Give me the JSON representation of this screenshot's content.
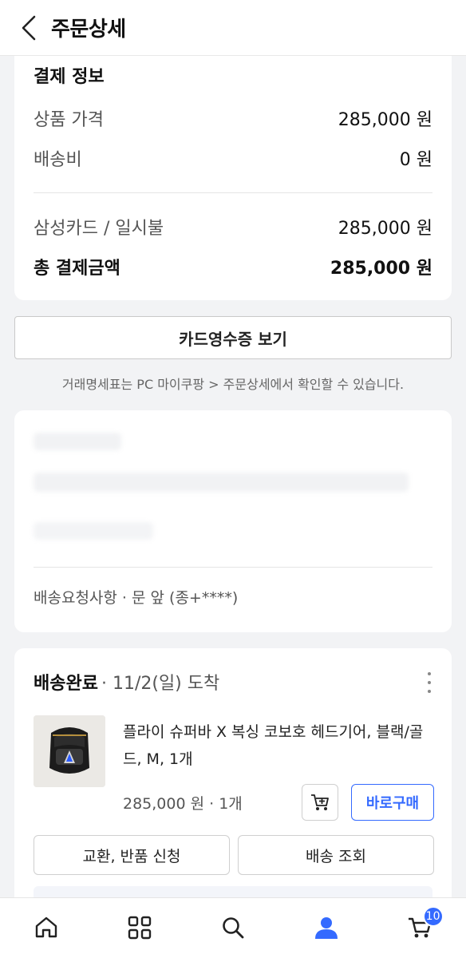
{
  "header": {
    "title": "주문상세"
  },
  "payment": {
    "section_title": "결제 정보",
    "rows": [
      {
        "label": "상품 가격",
        "value": "285,000 원"
      },
      {
        "label": "배송비",
        "value": "0 원"
      }
    ],
    "method": {
      "label": "삼성카드 / 일시불",
      "value": "285,000 원"
    },
    "total": {
      "label": "총 결제금액",
      "value": "285,000 원"
    }
  },
  "receipt_button": "카드영수증 보기",
  "receipt_note": "거래명세표는 PC 마이쿠팡 > 주문상세에서 확인할 수 있습니다.",
  "delivery": {
    "request": "배송요청사항 · 문 앞 (종+****)"
  },
  "order": {
    "status": "배송완료",
    "arrival": "· 11/2(일) 도착",
    "product_name": "플라이 슈퍼바 X 복싱 코보호 헤드기어, 블랙/골드, M, 1개",
    "price_qty": "285,000 원 · 1개",
    "buy_now": "바로구매",
    "exchange_return": "교환, 반품 신청",
    "track": "배송 조회"
  },
  "tabbar": {
    "items": [
      "home-icon",
      "categories-icon",
      "search-icon",
      "my-page-icon",
      "cart-icon"
    ],
    "cart_badge": "10",
    "accent": "#346aff"
  }
}
